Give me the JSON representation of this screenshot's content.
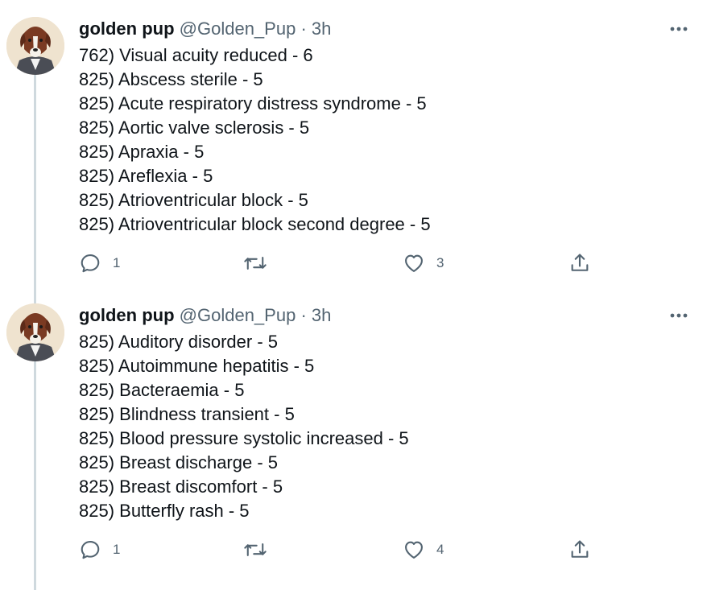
{
  "tweets": [
    {
      "author": "golden pup",
      "handle": "@Golden_Pup",
      "separator": "·",
      "time": "3h",
      "lines": [
        "762) Visual acuity reduced - 6",
        "825) Abscess sterile - 5",
        "825) Acute respiratory distress syndrome - 5",
        "825) Aortic valve sclerosis - 5",
        "825) Apraxia - 5",
        "825) Areflexia - 5",
        "825) Atrioventricular block - 5",
        "825) Atrioventricular block second degree - 5"
      ],
      "reply_count": "1",
      "retweet_count": "",
      "like_count": "3"
    },
    {
      "author": "golden pup",
      "handle": "@Golden_Pup",
      "separator": "·",
      "time": "3h",
      "lines": [
        "825) Auditory disorder - 5",
        "825) Autoimmune hepatitis - 5",
        "825) Bacteraemia - 5",
        "825) Blindness transient - 5",
        "825) Blood pressure systolic increased - 5",
        "825) Breast discharge - 5",
        "825) Breast discomfort - 5",
        "825) Butterfly rash - 5"
      ],
      "reply_count": "1",
      "retweet_count": "",
      "like_count": "4"
    }
  ],
  "icons": {
    "reply": "reply-icon",
    "retweet": "retweet-icon",
    "like": "heart-icon",
    "share": "share-icon",
    "more": "more-options-icon"
  },
  "colors": {
    "text": "#0f1419",
    "secondary": "#536471",
    "thread_line": "#cfd9de"
  }
}
